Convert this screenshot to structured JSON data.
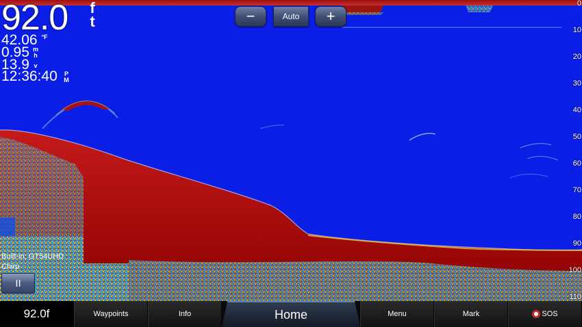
{
  "zoom": {
    "minus_label": "−",
    "auto_label": "Auto",
    "plus_label": "+"
  },
  "readouts": {
    "depth": "92.0",
    "depth_unit": "ft",
    "water_temp": "42.06",
    "water_temp_unit": "°F",
    "speed": "0.95",
    "speed_unit": "mh",
    "voltage": "13.9",
    "voltage_unit": "v",
    "time": "12:36:40",
    "time_unit": "PM"
  },
  "depth_scale": [
    "0",
    "10",
    "20",
    "30",
    "40",
    "50",
    "60",
    "70",
    "80",
    "90",
    "100",
    "110"
  ],
  "depth_scale_max": 110,
  "transducer": {
    "name": "Built-in: GT54UHD",
    "mode": "Chirp",
    "pause_label": "II"
  },
  "bottom_bar": {
    "depth": "92.0f",
    "waypoints": "Waypoints",
    "info": "Info",
    "home": "Home",
    "menu": "Menu",
    "mark": "Mark",
    "sos": "SOS"
  },
  "colors": {
    "water": "#0a1ee6",
    "bottom": "#8b0000",
    "accent": "#5b7fb5"
  }
}
